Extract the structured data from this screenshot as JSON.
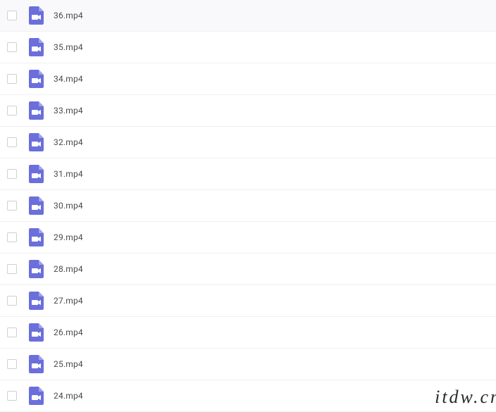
{
  "files": [
    {
      "name": "36.mp4",
      "type": "video"
    },
    {
      "name": "35.mp4",
      "type": "video"
    },
    {
      "name": "34.mp4",
      "type": "video"
    },
    {
      "name": "33.mp4",
      "type": "video"
    },
    {
      "name": "32.mp4",
      "type": "video"
    },
    {
      "name": "31.mp4",
      "type": "video"
    },
    {
      "name": "30.mp4",
      "type": "video"
    },
    {
      "name": "29.mp4",
      "type": "video"
    },
    {
      "name": "28.mp4",
      "type": "video"
    },
    {
      "name": "27.mp4",
      "type": "video"
    },
    {
      "name": "26.mp4",
      "type": "video"
    },
    {
      "name": "25.mp4",
      "type": "video"
    },
    {
      "name": "24.mp4",
      "type": "video"
    }
  ],
  "icon_color": "#6b6fdb",
  "watermark": "itdw.cn"
}
